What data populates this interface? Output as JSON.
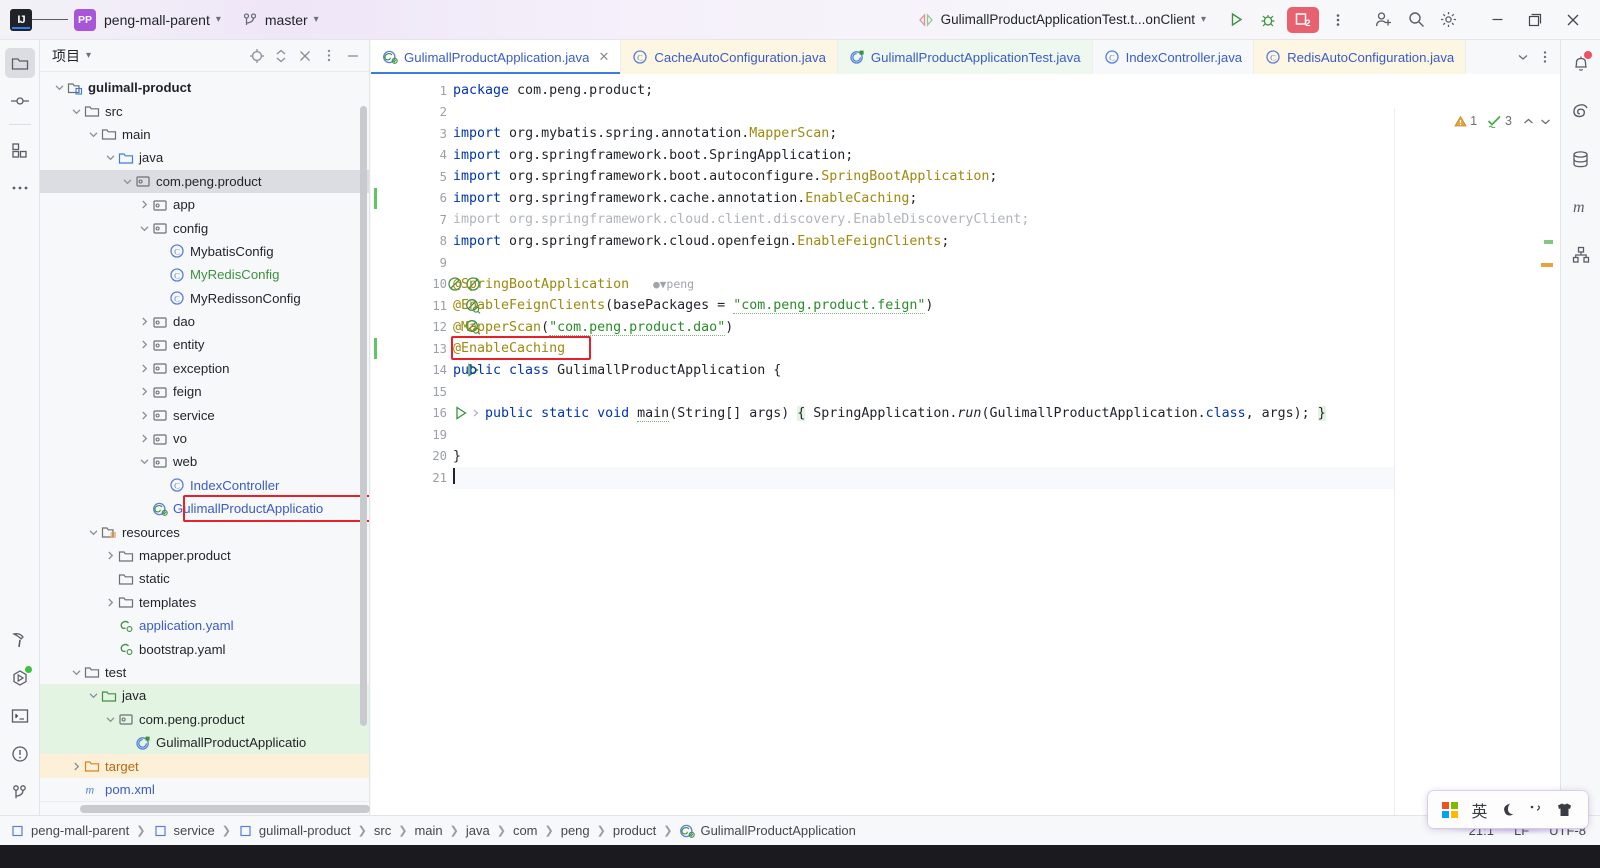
{
  "titlebar": {
    "logo_text": "IJ",
    "logo_icon": "intellij-idea-logo",
    "menu_icon": "hamburger-menu-icon",
    "project_badge": "PP",
    "project_name": "peng-mall-parent",
    "branch_icon": "git-branch-icon",
    "branch_name": "master",
    "run_config_icon": "run-config-nav-icon",
    "run_config_label": "GulimallProductApplicationTest.t...onClient",
    "run_icon": "run-icon",
    "debug_icon": "debug-icon",
    "debug_badge_count": "2",
    "more_icon": "more-vertical-icon",
    "invite_icon": "add-user-icon",
    "search_icon": "search-icon",
    "settings_icon": "gear-icon",
    "minimize_icon": "minimize-icon",
    "maximize_icon": "maximize-icon",
    "close_icon": "close-icon"
  },
  "left_rail": {
    "items": [
      {
        "name": "project-tool-window",
        "icon": "folder-icon",
        "selected": true
      },
      {
        "name": "commit-tool-window",
        "icon": "commit-node-icon",
        "selected": false
      },
      {
        "name": "bookmarks-tool-window",
        "icon": "blocks-icon",
        "selected": false
      },
      {
        "name": "more-tool-windows",
        "icon": "ellipsis-icon",
        "selected": false
      }
    ],
    "bottom_items": [
      {
        "name": "build-tool-window",
        "icon": "hammer-icon"
      },
      {
        "name": "run-tool-window",
        "icon": "run-dashboard-icon",
        "badge": "green-dot"
      },
      {
        "name": "terminal-tool-window",
        "icon": "terminal-icon"
      },
      {
        "name": "problems-tool-window",
        "icon": "warning-circle-icon"
      },
      {
        "name": "git-tool-window",
        "icon": "git-branch-icon"
      }
    ]
  },
  "right_rail": {
    "items": [
      {
        "name": "notifications",
        "icon": "bell-icon",
        "badge": "red-dot"
      },
      {
        "name": "spring-tool-window",
        "icon": "spring-spiral-icon"
      },
      {
        "name": "database-tool-window",
        "icon": "database-icon"
      },
      {
        "name": "maven-tool-window",
        "icon": "maven-m-icon"
      },
      {
        "name": "structure-tool-window",
        "icon": "hierarchy-icon"
      }
    ]
  },
  "project_panel": {
    "title": "项目",
    "title_chevron": "chevron-down-icon",
    "header_icons": [
      {
        "name": "locate-file-icon",
        "icon": "crosshair-icon"
      },
      {
        "name": "expand-collapse-icon",
        "icon": "updown-chevrons-icon"
      },
      {
        "name": "collapse-all-icon",
        "icon": "collapse-x-icon"
      },
      {
        "name": "panel-options-icon",
        "icon": "more-vertical-icon"
      },
      {
        "name": "hide-panel-icon",
        "icon": "minimize-icon"
      }
    ],
    "tree": [
      {
        "depth": 1,
        "arrow": "down",
        "icon": "module-icon",
        "label": "gulimall-product",
        "style": "bold"
      },
      {
        "depth": 2,
        "arrow": "down",
        "icon": "folder-icon",
        "label": "src",
        "style": ""
      },
      {
        "depth": 3,
        "arrow": "down",
        "icon": "folder-icon",
        "label": "main",
        "style": ""
      },
      {
        "depth": 4,
        "arrow": "down",
        "icon": "source-root-icon",
        "label": "java",
        "style": ""
      },
      {
        "depth": 5,
        "arrow": "down",
        "icon": "package-icon",
        "label": "com.peng.product",
        "style": "",
        "row": "selected"
      },
      {
        "depth": 6,
        "arrow": "right",
        "icon": "package-icon",
        "label": "app",
        "style": ""
      },
      {
        "depth": 6,
        "arrow": "down",
        "icon": "package-icon",
        "label": "config",
        "style": ""
      },
      {
        "depth": 7,
        "arrow": "none",
        "icon": "class-icon",
        "label": "MybatisConfig",
        "style": ""
      },
      {
        "depth": 7,
        "arrow": "none",
        "icon": "class-icon",
        "label": "MyRedisConfig",
        "style": "green"
      },
      {
        "depth": 7,
        "arrow": "none",
        "icon": "class-icon",
        "label": "MyRedissonConfig",
        "style": ""
      },
      {
        "depth": 6,
        "arrow": "right",
        "icon": "package-icon",
        "label": "dao",
        "style": ""
      },
      {
        "depth": 6,
        "arrow": "right",
        "icon": "package-icon",
        "label": "entity",
        "style": ""
      },
      {
        "depth": 6,
        "arrow": "right",
        "icon": "package-icon",
        "label": "exception",
        "style": ""
      },
      {
        "depth": 6,
        "arrow": "right",
        "icon": "package-icon",
        "label": "feign",
        "style": ""
      },
      {
        "depth": 6,
        "arrow": "right",
        "icon": "package-icon",
        "label": "service",
        "style": ""
      },
      {
        "depth": 6,
        "arrow": "right",
        "icon": "package-icon",
        "label": "vo",
        "style": ""
      },
      {
        "depth": 6,
        "arrow": "down",
        "icon": "package-icon",
        "label": "web",
        "style": ""
      },
      {
        "depth": 7,
        "arrow": "none",
        "icon": "class-icon",
        "label": "IndexController",
        "style": "blue"
      },
      {
        "depth": 6,
        "arrow": "none",
        "icon": "springboot-class-icon",
        "label": "GulimallProductApplicatio",
        "style": "blue",
        "highlight": true
      },
      {
        "depth": 3,
        "arrow": "down",
        "icon": "resource-root-icon",
        "label": "resources",
        "style": ""
      },
      {
        "depth": 4,
        "arrow": "right",
        "icon": "folder-icon",
        "label": "mapper.product",
        "style": ""
      },
      {
        "depth": 4,
        "arrow": "none",
        "icon": "folder-icon",
        "label": "static",
        "style": ""
      },
      {
        "depth": 4,
        "arrow": "right",
        "icon": "folder-icon",
        "label": "templates",
        "style": ""
      },
      {
        "depth": 4,
        "arrow": "none",
        "icon": "yaml-icon",
        "label": "application.yaml",
        "style": "blue"
      },
      {
        "depth": 4,
        "arrow": "none",
        "icon": "yaml-icon",
        "label": "bootstrap.yaml",
        "style": ""
      },
      {
        "depth": 2,
        "arrow": "down",
        "icon": "folder-icon",
        "label": "test",
        "style": ""
      },
      {
        "depth": 3,
        "arrow": "down",
        "icon": "test-root-icon",
        "label": "java",
        "style": "",
        "row": "green"
      },
      {
        "depth": 4,
        "arrow": "down",
        "icon": "package-icon",
        "label": "com.peng.product",
        "style": "",
        "row": "green"
      },
      {
        "depth": 5,
        "arrow": "none",
        "icon": "test-class-icon",
        "label": "GulimallProductApplicatio",
        "style": "",
        "row": "green"
      },
      {
        "depth": 2,
        "arrow": "right",
        "icon": "target-folder-icon",
        "label": "target",
        "style": "orange",
        "row": "orange"
      },
      {
        "depth": 2,
        "arrow": "none",
        "icon": "maven-m-icon",
        "label": "pom.xml",
        "style": "blue"
      }
    ]
  },
  "editor": {
    "tabs": [
      {
        "label": "GulimallProductApplication.java",
        "icon": "springboot-class-icon",
        "active": true,
        "bg": "white",
        "closable": true
      },
      {
        "label": "CacheAutoConfiguration.java",
        "icon": "class-icon",
        "active": false,
        "bg": "cream",
        "closable": false
      },
      {
        "label": "GulimallProductApplicationTest.java",
        "icon": "test-class-icon",
        "active": false,
        "bg": "mint",
        "closable": false
      },
      {
        "label": "IndexController.java",
        "icon": "class-icon",
        "active": false,
        "bg": "white",
        "closable": false
      },
      {
        "label": "RedisAutoConfiguration.java",
        "icon": "class-icon",
        "active": false,
        "bg": "cream",
        "closable": false
      }
    ],
    "tab_overflow_icon": "chevron-down-icon",
    "tab_options_icon": "more-vertical-icon",
    "inspection": {
      "warning_icon": "warning-triangle-icon",
      "warning_count": "1",
      "weak_warning_icon": "green-check-icon",
      "weak_warning_count": "3",
      "collapse_icon": "chevron-up-icon",
      "expand_icon": "chevron-down-icon"
    },
    "line_numbers": [
      "1",
      "2",
      "3",
      "4",
      "5",
      "6",
      "7",
      "8",
      "9",
      "10",
      "11",
      "12",
      "13",
      "14",
      "15",
      "16",
      "19",
      "20",
      "21"
    ],
    "gutter_icons": {
      "10": [
        "bean-icon",
        "bean-disabled-icon"
      ],
      "11": [
        "bean-search-icon"
      ],
      "12": [
        "bean-search-icon"
      ],
      "14": [
        "run-gutter-icon"
      ],
      "16": [
        "run-gutter-icon",
        "fold-right-icon"
      ]
    },
    "vcs_changed_lines": [
      "6",
      "13"
    ],
    "code_lines": [
      {
        "n": "1",
        "segments": [
          {
            "t": "package",
            "c": "kw"
          },
          {
            "t": " com.peng.product;",
            "c": "pln"
          }
        ]
      },
      {
        "n": "2",
        "segments": []
      },
      {
        "n": "3",
        "segments": [
          {
            "t": "import",
            "c": "kw"
          },
          {
            "t": " org.mybatis.spring.annotation.",
            "c": "pln"
          },
          {
            "t": "MapperScan",
            "c": "ann"
          },
          {
            "t": ";",
            "c": "pln"
          }
        ]
      },
      {
        "n": "4",
        "segments": [
          {
            "t": "import",
            "c": "kw"
          },
          {
            "t": " org.springframework.boot.SpringApplication;",
            "c": "pln"
          }
        ]
      },
      {
        "n": "5",
        "segments": [
          {
            "t": "import",
            "c": "kw"
          },
          {
            "t": " org.springframework.boot.autoconfigure.",
            "c": "pln"
          },
          {
            "t": "SpringBootApplication",
            "c": "ann"
          },
          {
            "t": ";",
            "c": "pln"
          }
        ]
      },
      {
        "n": "6",
        "segments": [
          {
            "t": "import",
            "c": "kw"
          },
          {
            "t": " org.springframework.cache.annotation.",
            "c": "pln"
          },
          {
            "t": "EnableCaching",
            "c": "ann"
          },
          {
            "t": ";",
            "c": "pln"
          }
        ]
      },
      {
        "n": "7",
        "segments": [
          {
            "t": "import org.springframework.cloud.client.discovery.EnableDiscoveryClient;",
            "c": "dim"
          }
        ]
      },
      {
        "n": "8",
        "segments": [
          {
            "t": "import",
            "c": "kw"
          },
          {
            "t": " org.springframework.cloud.openfeign.",
            "c": "pln"
          },
          {
            "t": "EnableFeignClients",
            "c": "ann"
          },
          {
            "t": ";",
            "c": "pln"
          }
        ]
      },
      {
        "n": "9",
        "segments": []
      },
      {
        "n": "10",
        "segments": [
          {
            "t": "@SpringBootApplication",
            "c": "ann"
          },
          {
            "t": "   ",
            "c": "pln"
          },
          {
            "t": "peng",
            "c": "hint"
          }
        ]
      },
      {
        "n": "11",
        "segments": [
          {
            "t": "@EnableFeignClients",
            "c": "ann"
          },
          {
            "t": "(basePackages = ",
            "c": "pln"
          },
          {
            "t": "\"com.peng.product.feign\"",
            "c": "str"
          },
          {
            "t": ")",
            "c": "pln"
          }
        ]
      },
      {
        "n": "12",
        "segments": [
          {
            "t": "@MapperScan",
            "c": "ann"
          },
          {
            "t": "(",
            "c": "pln"
          },
          {
            "t": "\"com.peng.product.dao\"",
            "c": "str"
          },
          {
            "t": ")",
            "c": "pln"
          }
        ]
      },
      {
        "n": "13",
        "segments": [
          {
            "t": "@EnableCaching",
            "c": "ann"
          }
        ],
        "highlight": true
      },
      {
        "n": "14",
        "segments": [
          {
            "t": "public class",
            "c": "kw"
          },
          {
            "t": " GulimallProductApplication {",
            "c": "pln"
          }
        ]
      },
      {
        "n": "15",
        "segments": []
      },
      {
        "n": "16",
        "segments": [
          {
            "t": "    ",
            "c": "pln"
          },
          {
            "t": "public static void",
            "c": "kw"
          },
          {
            "t": " ",
            "c": "pln"
          },
          {
            "t": "main",
            "c": "mth"
          },
          {
            "t": "(String[] args) ",
            "c": "pln"
          },
          {
            "t": "{",
            "c": "br"
          },
          {
            "t": " SpringApplication.",
            "c": "pln"
          },
          {
            "t": "run",
            "c": "ital"
          },
          {
            "t": "(GulimallProductApplication.",
            "c": "pln"
          },
          {
            "t": "class",
            "c": "kw"
          },
          {
            "t": ", args); ",
            "c": "pln"
          },
          {
            "t": "}",
            "c": "br"
          }
        ]
      },
      {
        "n": "19",
        "segments": []
      },
      {
        "n": "20",
        "segments": [
          {
            "t": "}",
            "c": "pln"
          }
        ]
      },
      {
        "n": "21",
        "segments": [],
        "caret": true
      }
    ]
  },
  "statusbar": {
    "breadcrumbs": [
      {
        "label": "peng-mall-parent",
        "icon": "module-square-icon"
      },
      {
        "label": "service",
        "icon": "module-square-icon"
      },
      {
        "label": "gulimall-product",
        "icon": "module-square-icon"
      },
      {
        "label": "src",
        "icon": ""
      },
      {
        "label": "main",
        "icon": ""
      },
      {
        "label": "java",
        "icon": ""
      },
      {
        "label": "com",
        "icon": ""
      },
      {
        "label": "peng",
        "icon": ""
      },
      {
        "label": "product",
        "icon": ""
      },
      {
        "label": "GulimallProductApplication",
        "icon": "springboot-class-icon"
      }
    ],
    "caret_position": "21:1",
    "line_separator": "LF",
    "encoding": "UTF-8"
  },
  "ime_popup": {
    "windows_icon": "windows-logo-icon",
    "mode_label": "英",
    "moon_icon": "moon-icon",
    "comma_icon": "punctuation-icon",
    "skin_icon": "tshirt-icon"
  },
  "colors": {
    "accent": "#3b7ddd",
    "keyword": "#0033b3",
    "annotation": "#9e880d",
    "string": "#2a8c2a",
    "highlight_box": "#e8202a",
    "debug_badge": "#e8616e",
    "project_badge": "#a855d8",
    "test_scope": "#e4f4e2",
    "target_scope": "#fdf0d8"
  }
}
